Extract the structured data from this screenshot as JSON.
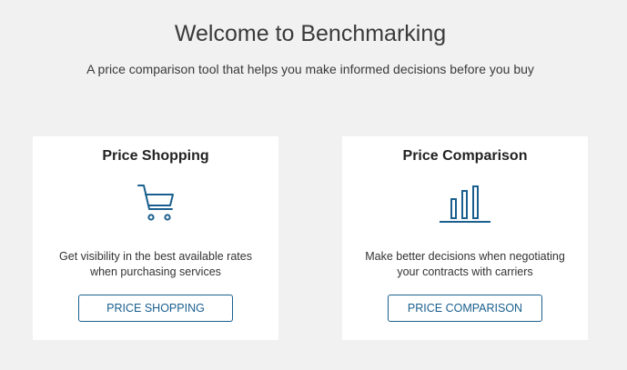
{
  "header": {
    "title": "Welcome to Benchmarking",
    "subtitle": "A price comparison tool that helps you make informed decisions before you buy"
  },
  "cards": [
    {
      "title": "Price Shopping",
      "icon": "shopping-cart-icon",
      "description_lines": [
        "Get visibility in the best available rates",
        "when purchasing services"
      ],
      "button_label": "PRICE SHOPPING"
    },
    {
      "title": "Price Comparison",
      "icon": "bar-chart-icon",
      "description_lines": [
        "Make better decisions when negotiating",
        "your contracts with carriers"
      ],
      "button_label": "PRICE COMPARISON"
    }
  ],
  "colors": {
    "background": "#f1f1f1",
    "card_background": "#ffffff",
    "accent": "#1a5f8e",
    "text": "#333333"
  }
}
